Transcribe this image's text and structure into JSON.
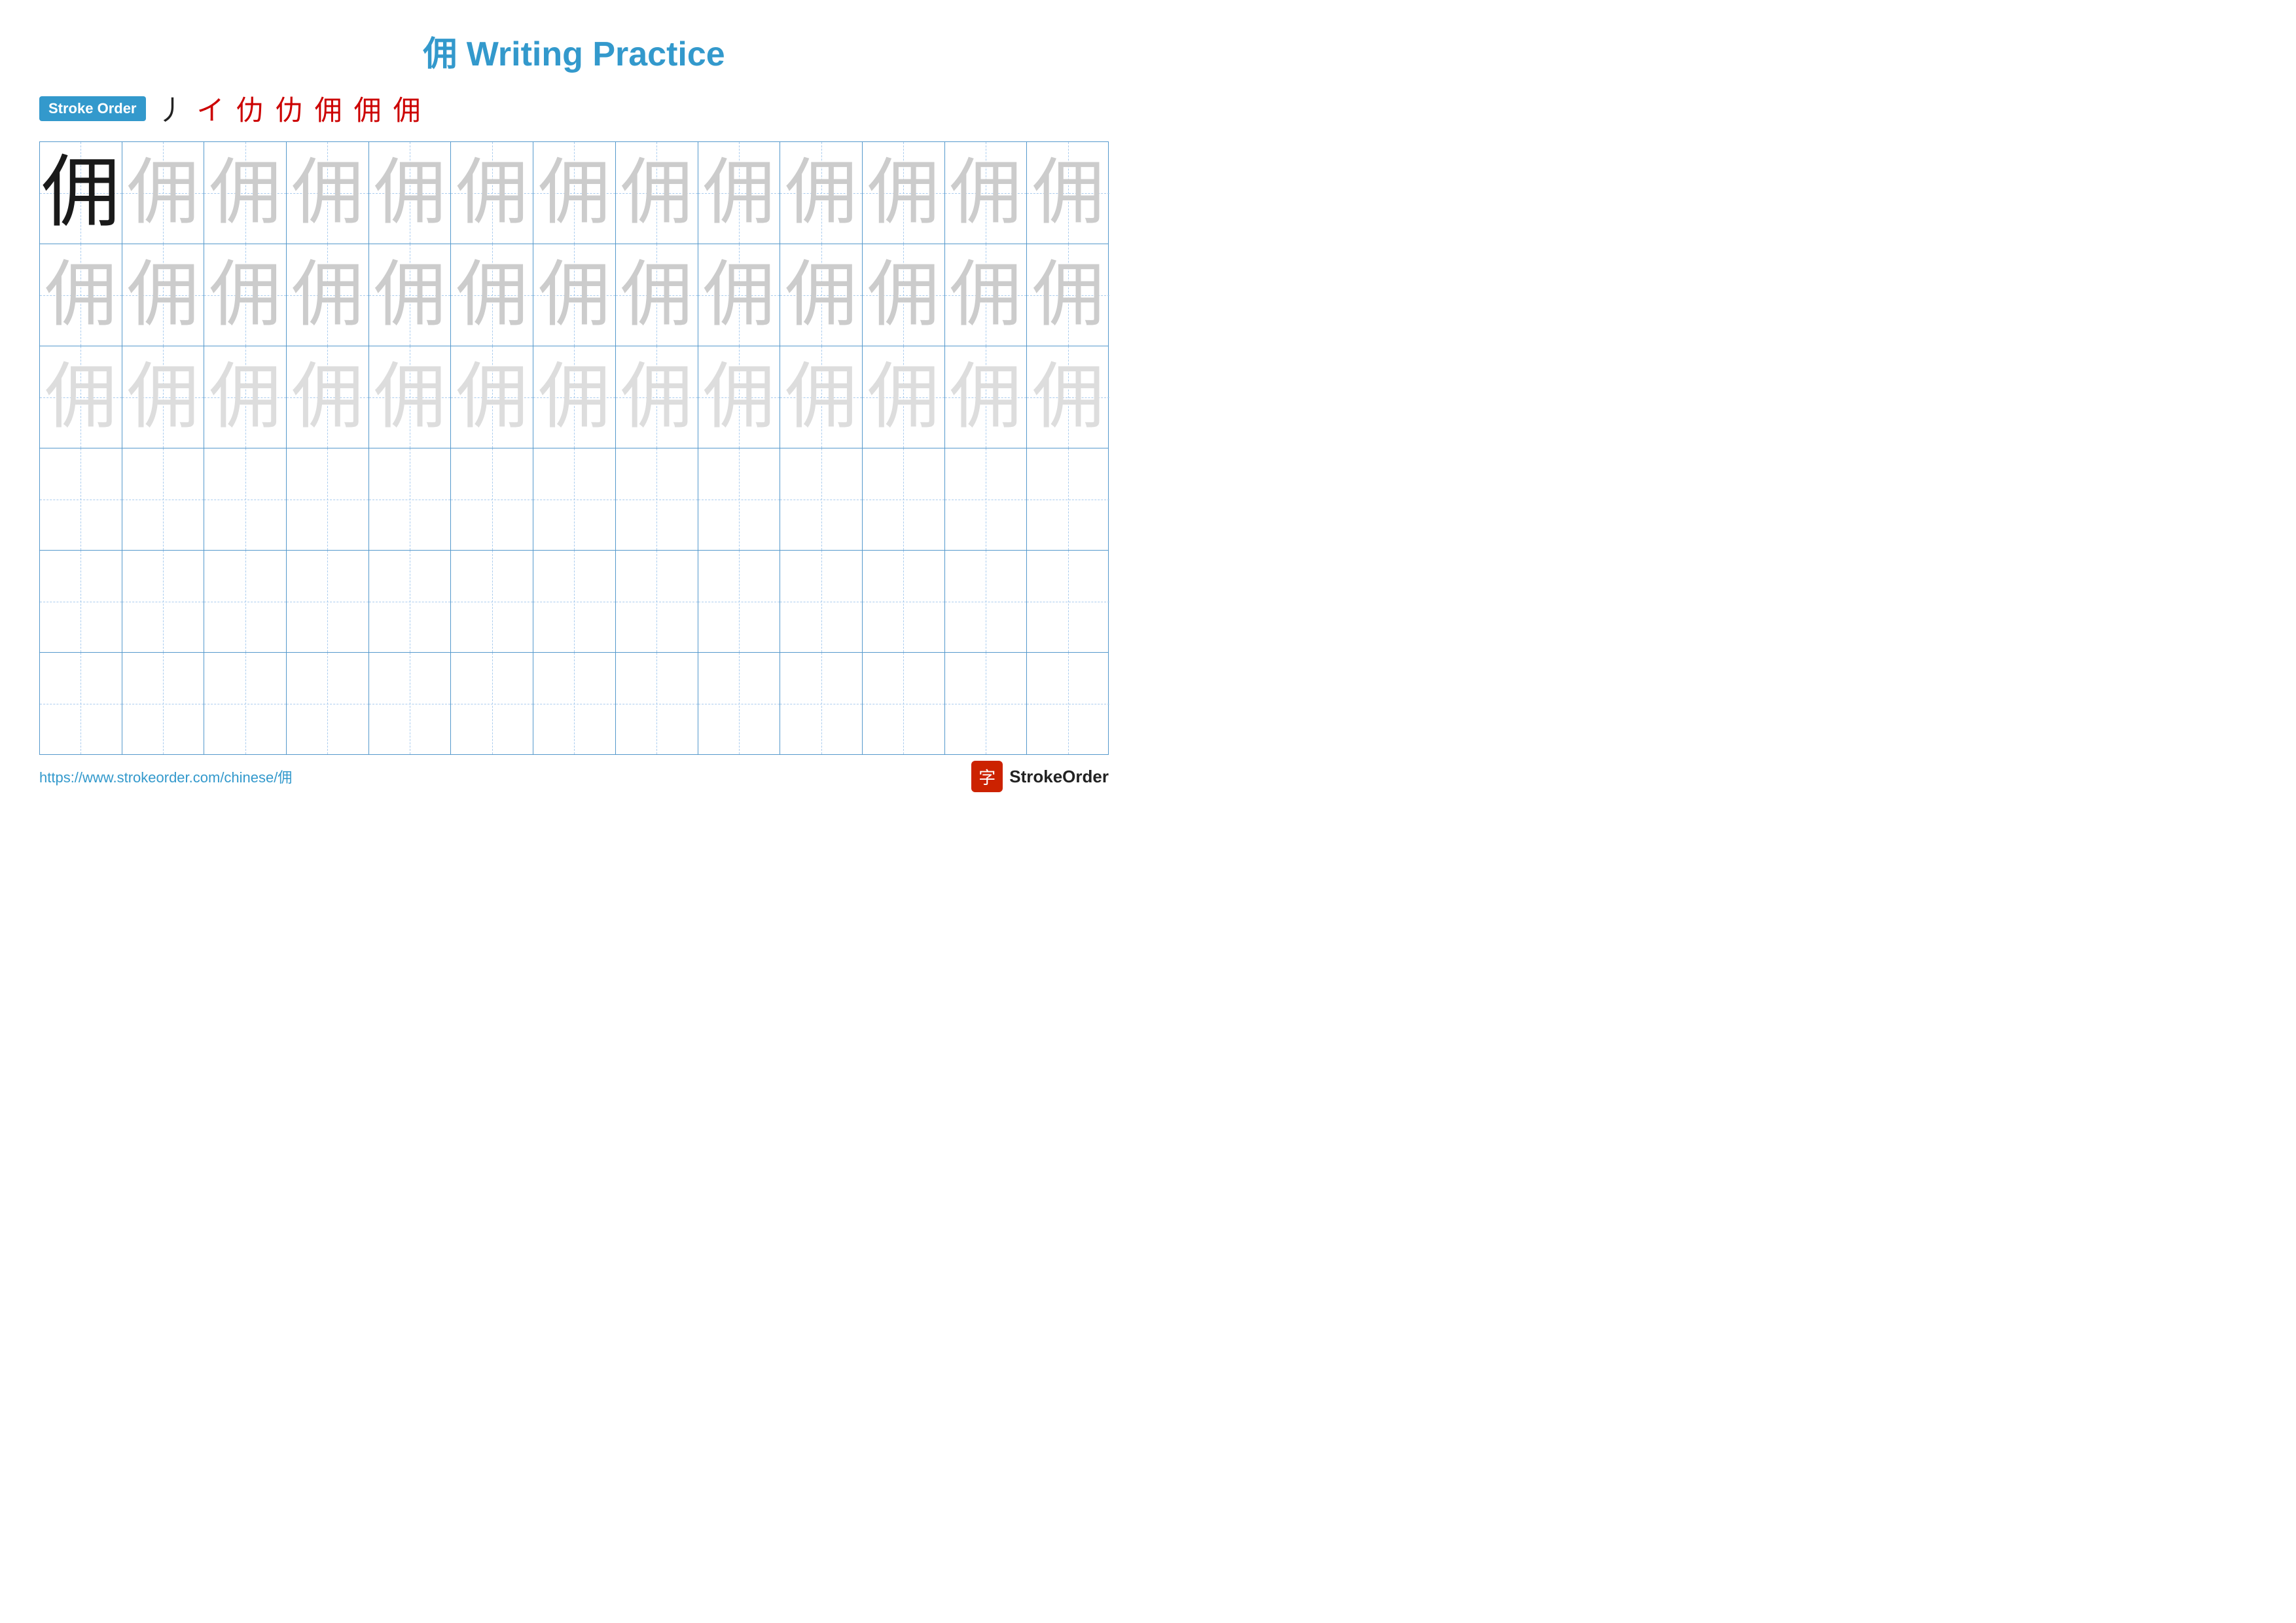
{
  "title": {
    "chinese_char": "佣",
    "text": "Writing Practice",
    "full": "佣 Writing Practice"
  },
  "stroke_order": {
    "badge_label": "Stroke Order",
    "strokes": [
      "丿",
      "イ",
      "仂",
      "仂",
      "佣",
      "佣",
      "佣"
    ]
  },
  "grid": {
    "rows": 6,
    "cols": 13,
    "char": "佣",
    "row_types": [
      "dark-then-light",
      "light",
      "lighter",
      "empty",
      "empty",
      "empty"
    ]
  },
  "footer": {
    "url": "https://www.strokeorder.com/chinese/佣",
    "brand_icon": "字",
    "brand_name": "StrokeOrder"
  }
}
